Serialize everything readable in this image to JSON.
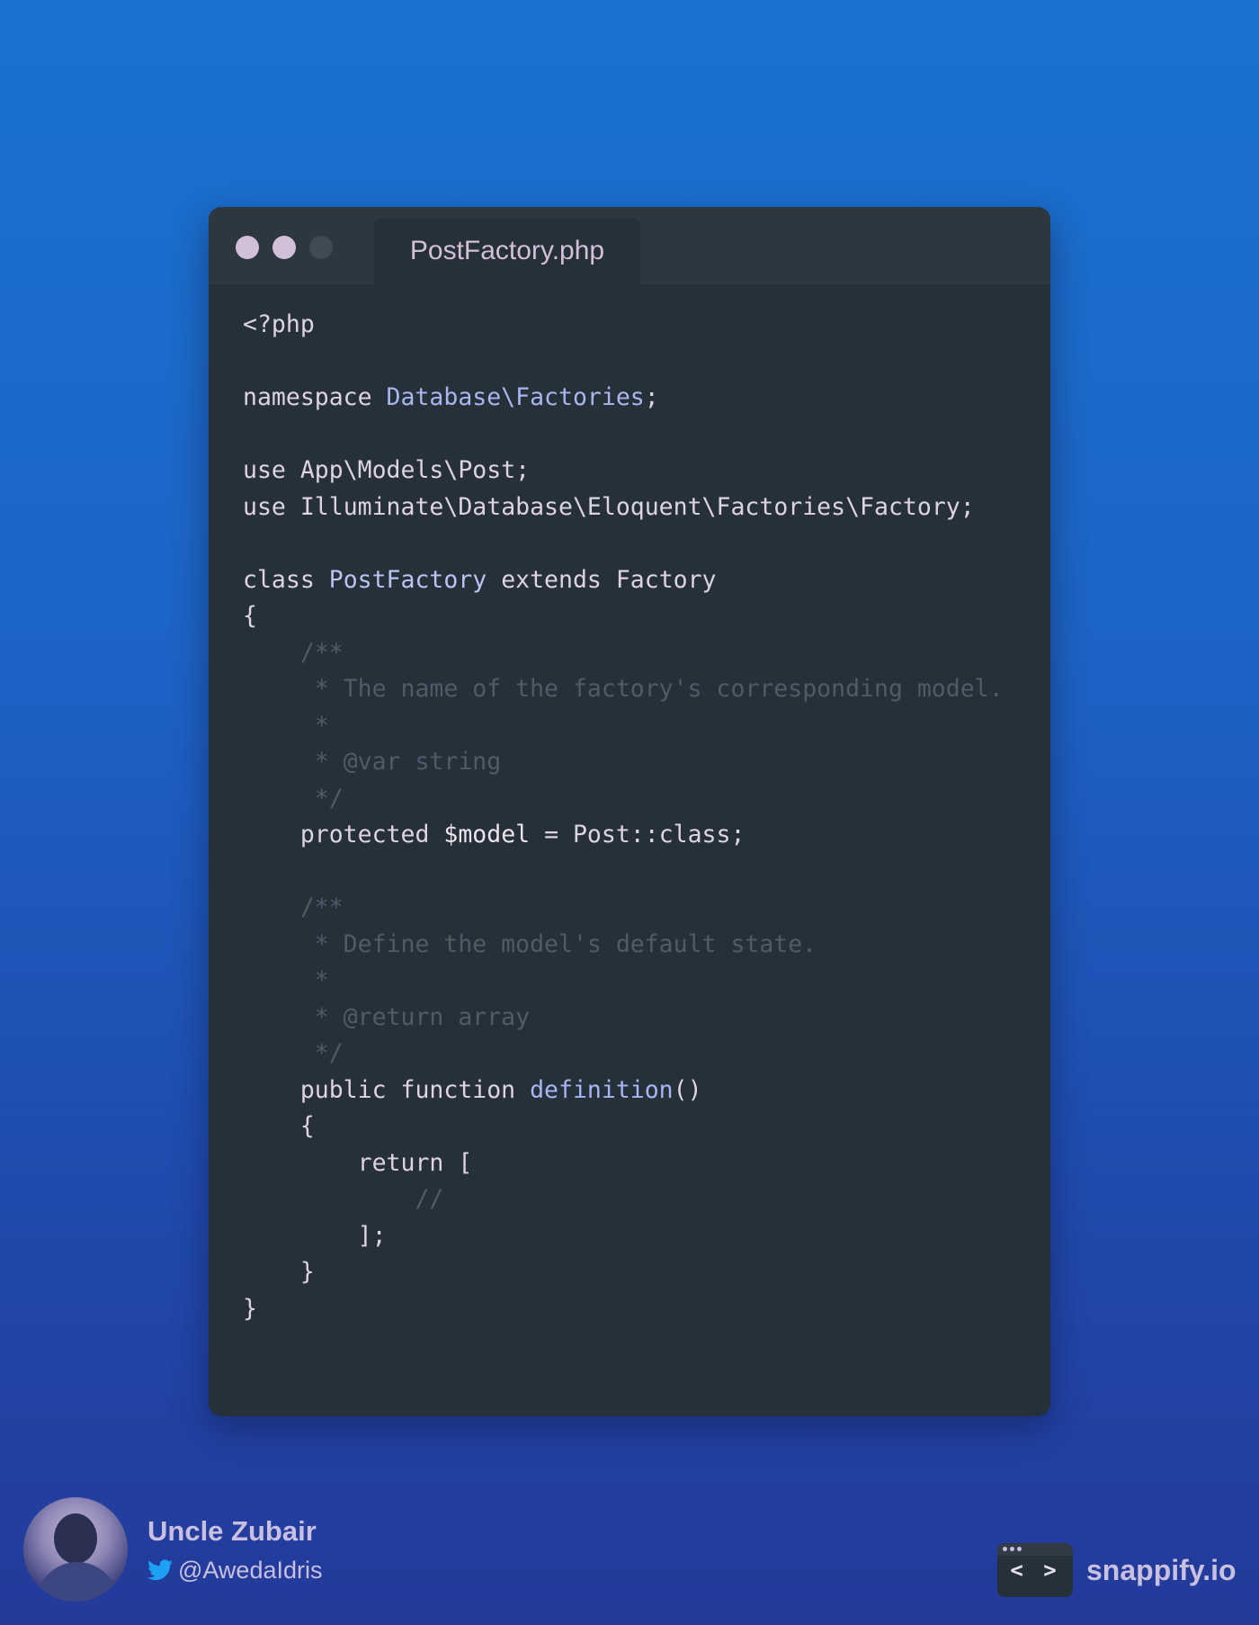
{
  "window": {
    "tab_title": "PostFactory.php"
  },
  "code_lines": [
    [
      {
        "t": "<?php",
        "c": "plain"
      }
    ],
    [],
    [
      {
        "t": "namespace ",
        "c": "kw"
      },
      {
        "t": "Database\\Factories",
        "c": "ns"
      },
      {
        "t": ";",
        "c": "plain"
      }
    ],
    [],
    [
      {
        "t": "use ",
        "c": "kw"
      },
      {
        "t": "App\\Models\\Post;",
        "c": "plain"
      }
    ],
    [
      {
        "t": "use ",
        "c": "kw"
      },
      {
        "t": "Illuminate\\Database\\Eloquent\\Factories\\Factory;",
        "c": "plain"
      }
    ],
    [],
    [
      {
        "t": "class ",
        "c": "kw"
      },
      {
        "t": "PostFactory",
        "c": "cls"
      },
      {
        "t": " extends ",
        "c": "kw"
      },
      {
        "t": "Factory",
        "c": "plain"
      }
    ],
    [
      {
        "t": "{",
        "c": "plain"
      }
    ],
    [
      {
        "t": "    /**",
        "c": "cm"
      }
    ],
    [
      {
        "t": "     * The name of the factory's corresponding model.",
        "c": "cm"
      }
    ],
    [
      {
        "t": "     *",
        "c": "cm"
      }
    ],
    [
      {
        "t": "     * @var string",
        "c": "cm"
      }
    ],
    [
      {
        "t": "     */",
        "c": "cm"
      }
    ],
    [
      {
        "t": "    protected ",
        "c": "kw"
      },
      {
        "t": "$model",
        "c": "var"
      },
      {
        "t": " = Post::class;",
        "c": "plain"
      }
    ],
    [],
    [
      {
        "t": "    /**",
        "c": "cm"
      }
    ],
    [
      {
        "t": "     * Define the model's default state.",
        "c": "cm"
      }
    ],
    [
      {
        "t": "     *",
        "c": "cm"
      }
    ],
    [
      {
        "t": "     * @return array",
        "c": "cm"
      }
    ],
    [
      {
        "t": "     */",
        "c": "cm"
      }
    ],
    [
      {
        "t": "    public function ",
        "c": "kw"
      },
      {
        "t": "definition",
        "c": "fn"
      },
      {
        "t": "()",
        "c": "plain"
      }
    ],
    [
      {
        "t": "    {",
        "c": "plain"
      }
    ],
    [
      {
        "t": "        return [",
        "c": "plain"
      }
    ],
    [
      {
        "t": "            //",
        "c": "cm"
      }
    ],
    [
      {
        "t": "        ];",
        "c": "plain"
      }
    ],
    [
      {
        "t": "    }",
        "c": "plain"
      }
    ],
    [
      {
        "t": "}",
        "c": "plain"
      }
    ]
  ],
  "author": {
    "name": "Uncle Zubair",
    "handle": "@AwedaIdris",
    "icon": "twitter-icon"
  },
  "brand": {
    "name": "snappify.io",
    "logo_glyph": "< >"
  },
  "colors": {
    "background_top": "#1b72cf",
    "background_bottom": "#233a9a",
    "editor_bg": "#263039",
    "comment": "#4e5b68",
    "accent": "#d2bfd8"
  }
}
